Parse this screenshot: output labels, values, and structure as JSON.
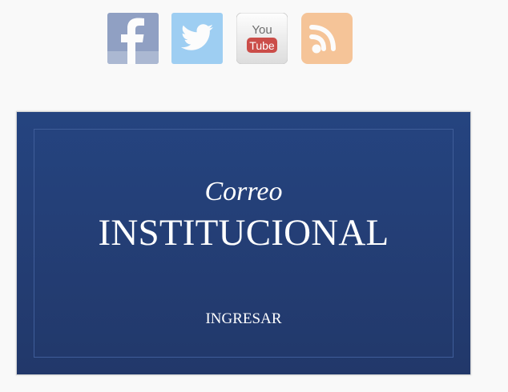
{
  "social": {
    "icons": [
      {
        "name": "facebook-icon",
        "glyph": "f"
      },
      {
        "name": "twitter-icon",
        "glyph": "bird"
      },
      {
        "name": "youtube-icon",
        "line1": "You",
        "line2": "Tube"
      },
      {
        "name": "rss-icon",
        "glyph": "rss"
      }
    ]
  },
  "mail_card": {
    "subtitle": "Correo",
    "title": "INSTITUCIONAL",
    "login_label": "INGRESAR"
  },
  "colors": {
    "card_top": "#254480",
    "card_bottom": "#22386a",
    "facebook": "#3b5998",
    "twitter": "#55acee",
    "youtube_red": "#c4302b",
    "rss": "#f26522"
  }
}
